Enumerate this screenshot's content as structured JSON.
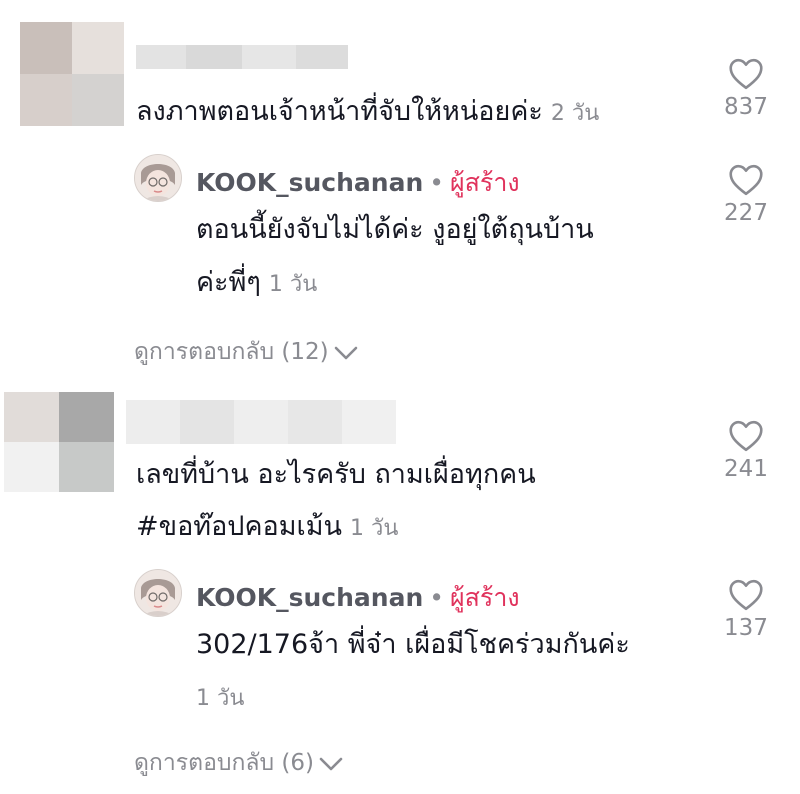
{
  "comments": [
    {
      "text": "ลงภาพตอนเจ้าหน้าที่จับให้หน่อยค่ะ",
      "time": "2 วัน",
      "likes": "837",
      "reply": {
        "username": "KOOK_suchanan",
        "separator": "•",
        "badge": "ผู้สร้าง",
        "text_line1": "ตอนนี้ยังจับไม่ได้ค่ะ งูอยู่ใต้ถุนบ้าน",
        "text_line2": "ค่ะพี่ๆ",
        "time": "1 วัน",
        "likes": "227"
      },
      "view_replies": "ดูการตอบกลับ (12)"
    },
    {
      "text_line1": "เลขที่บ้าน อะไรครับ ถามเผื่อทุกคน",
      "text_line2": "#ขอท๊อปคอมเม้น",
      "time": "1 วัน",
      "likes": "241",
      "reply": {
        "username": "KOOK_suchanan",
        "separator": "•",
        "badge": "ผู้สร้าง",
        "text_line1": "302/176จ้า พี่จ๋า เผื่อมีโชคร่วมกันค่ะ",
        "time": "1 วัน",
        "likes": "137"
      },
      "view_replies": "ดูการตอบกลับ (6)"
    }
  ],
  "icons": {
    "like": "heart-outline-icon",
    "expand": "chevron-down-icon"
  },
  "colors": {
    "creator_badge": "#e0325c",
    "muted": "#8a8b91",
    "text": "#161823"
  }
}
